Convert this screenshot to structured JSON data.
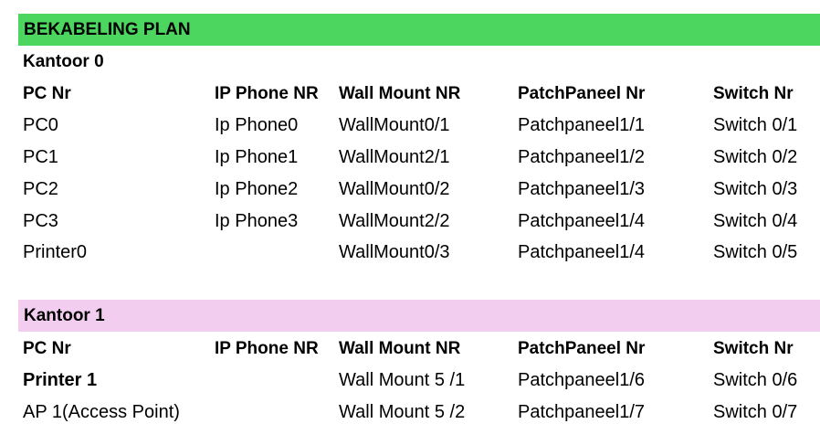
{
  "title": "BEKABELING PLAN",
  "section0": {
    "name": "Kantoor 0",
    "headers": [
      "PC Nr",
      "IP Phone NR",
      "Wall Mount NR",
      "PatchPaneel Nr",
      "Switch Nr"
    ],
    "rows": [
      [
        "PC0",
        "Ip Phone0",
        "WallMount0/1",
        "Patchpaneel1/1",
        "Switch 0/1"
      ],
      [
        "PC1",
        "Ip Phone1",
        "WallMount2/1",
        "Patchpaneel1/2",
        "Switch 0/2"
      ],
      [
        "PC2",
        "Ip Phone2",
        "WallMount0/2",
        "Patchpaneel1/3",
        "Switch 0/3"
      ],
      [
        "PC3",
        "Ip Phone3",
        "WallMount2/2",
        "Patchpaneel1/4",
        "Switch 0/4"
      ],
      [
        "Printer0",
        "",
        "WallMount0/3",
        "Patchpaneel1/4",
        "Switch 0/5"
      ]
    ]
  },
  "section1": {
    "name": "Kantoor 1",
    "headers": [
      "PC Nr",
      "IP Phone NR",
      "Wall Mount NR",
      "PatchPaneel Nr",
      "Switch Nr"
    ],
    "rows": [
      [
        "Printer 1",
        "",
        "Wall Mount 5 /1",
        "Patchpaneel1/6",
        "Switch 0/6"
      ],
      [
        "AP 1(Access Point)",
        "",
        "Wall Mount 5 /2",
        "Patchpaneel1/7",
        "Switch 0/7"
      ]
    ]
  },
  "colors": {
    "title_band": "#4cd660",
    "section_band": "#f2cdef"
  }
}
